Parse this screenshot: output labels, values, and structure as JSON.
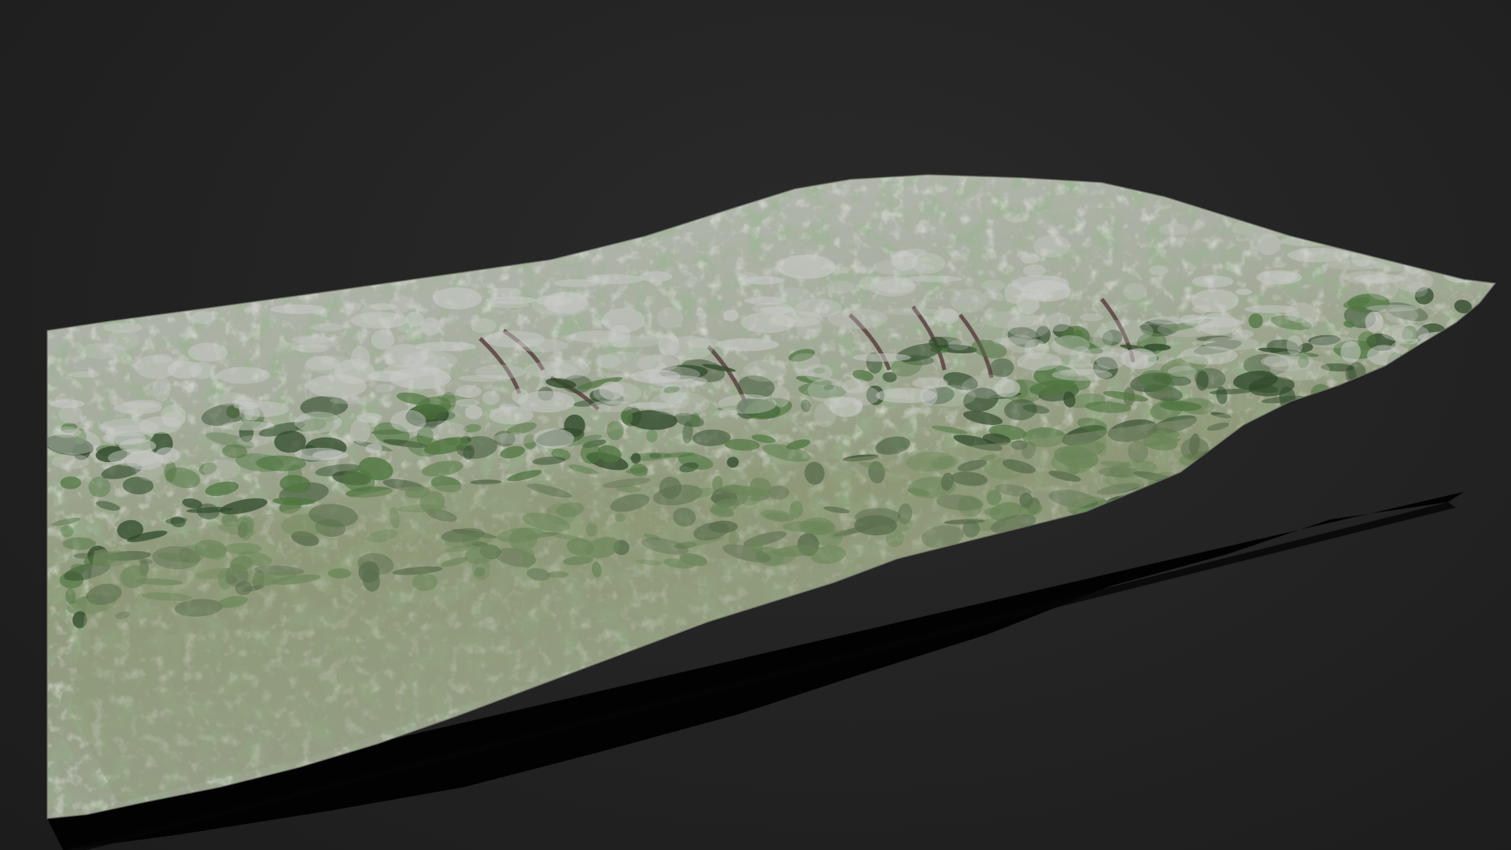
{
  "scene": {
    "subject": "terrain-mesh",
    "background_color": "#242424",
    "shadow_color": "#000000",
    "terrain_colors": {
      "rock_light": "#c9cbc8",
      "rock_mid": "#9ea29d",
      "vegetation": "#4f7640",
      "vegetation_dark": "#2f4a2a",
      "meadow": "#8f9a78",
      "crevice": "#4a2a2c"
    }
  }
}
